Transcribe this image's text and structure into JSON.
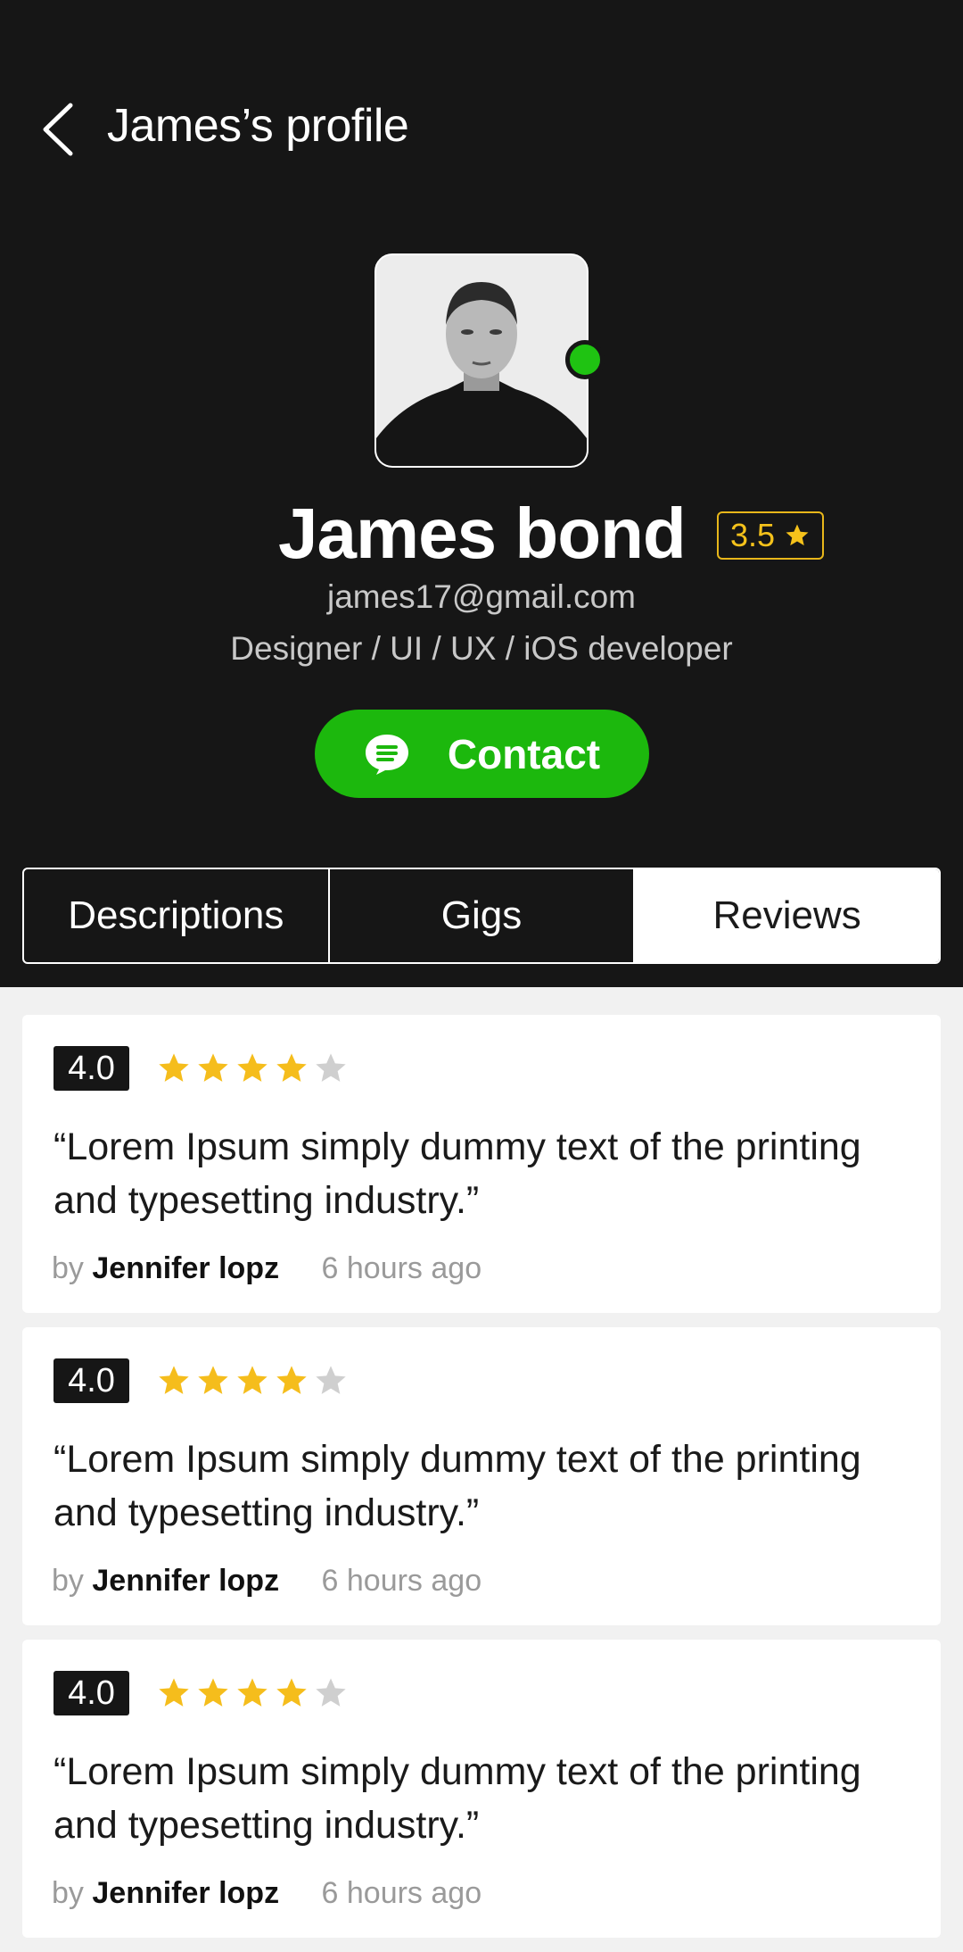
{
  "header": {
    "title": "James’s profile"
  },
  "profile": {
    "name": "James bond",
    "rating": "3.5",
    "email": "james17@gmail.com",
    "role": "Designer / UI / UX / iOS developer",
    "online": true,
    "status_color": "#1fc312"
  },
  "contact": {
    "label": "Contact",
    "color": "#1cb80d"
  },
  "tabs": [
    {
      "label": "Descriptions",
      "active": false
    },
    {
      "label": "Gigs",
      "active": false
    },
    {
      "label": "Reviews",
      "active": true
    }
  ],
  "reviews": [
    {
      "score": "4.0",
      "stars": 4,
      "max_stars": 5,
      "text": "“Lorem Ipsum simply dummy text of the printing and typesetting industry.”",
      "by": "by",
      "author": "Jennifer lopz",
      "time": "6 hours ago"
    },
    {
      "score": "4.0",
      "stars": 4,
      "max_stars": 5,
      "text": "“Lorem Ipsum simply dummy text of the printing and typesetting industry.”",
      "by": "by",
      "author": "Jennifer lopz",
      "time": "6 hours ago"
    },
    {
      "score": "4.0",
      "stars": 4,
      "max_stars": 5,
      "text": "“Lorem Ipsum simply dummy text of the printing and typesetting industry.”",
      "by": "by",
      "author": "Jennifer lopz",
      "time": "6 hours ago"
    }
  ],
  "colors": {
    "star_filled": "#f5bd1c",
    "star_empty": "#cfcfcf",
    "background_dark": "#161616"
  }
}
